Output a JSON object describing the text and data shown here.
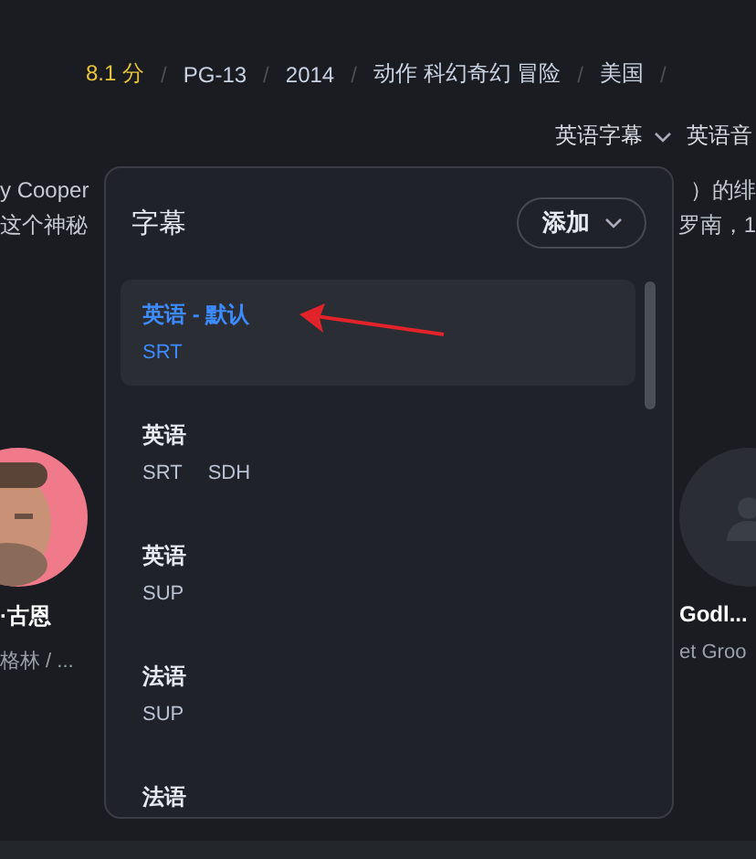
{
  "meta": [
    {
      "text": "8.1 分",
      "kind": "rating"
    },
    {
      "text": "/",
      "kind": "separator"
    },
    {
      "text": "PG-13",
      "kind": "plain"
    },
    {
      "text": "/",
      "kind": "separator"
    },
    {
      "text": "2014",
      "kind": "plain"
    },
    {
      "text": "/",
      "kind": "separator"
    },
    {
      "text": "动作 科幻奇幻 冒险",
      "kind": "plain"
    },
    {
      "text": "/",
      "kind": "separator"
    },
    {
      "text": "美国",
      "kind": "plain"
    },
    {
      "text": "/",
      "kind": "separator"
    }
  ],
  "track_bar": {
    "subtitle": "英语字幕",
    "audio": "英语音"
  },
  "description": [
    {
      "left": "y Cooper",
      "right": "）的绯"
    },
    {
      "left": "这个神秘",
      "right": "罗南，1"
    }
  ],
  "cast": [
    {
      "name": "·古恩",
      "role": "格林 / ..."
    },
    {
      "name": "Godl...",
      "role": "et Groo",
      "kind": "placeholder"
    }
  ],
  "popup": {
    "title": "字幕",
    "add_button": "添加",
    "items": [
      {
        "language": "英语 - 默认",
        "formats": [
          "SRT"
        ],
        "selected": true
      },
      {
        "language": "英语",
        "formats": [
          "SRT",
          "SDH"
        ],
        "selected": false
      },
      {
        "language": "英语",
        "formats": [
          "SUP"
        ],
        "selected": false
      },
      {
        "language": "法语",
        "formats": [
          "SUP"
        ],
        "selected": false
      },
      {
        "language": "法语",
        "selected": false
      }
    ]
  }
}
